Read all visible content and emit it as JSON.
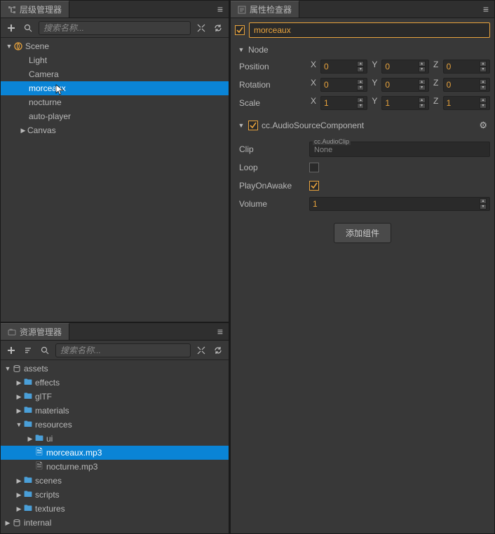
{
  "hierarchy": {
    "title": "层级管理器",
    "search_placeholder": "搜索名称...",
    "scene_label": "Scene",
    "nodes": [
      "Light",
      "Camera",
      "morceaux",
      "nocturne",
      "auto-player",
      "Canvas"
    ],
    "selected": "morceaux"
  },
  "assets": {
    "title": "资源管理器",
    "search_placeholder": "搜索名称...",
    "root": "assets",
    "folders": [
      "effects",
      "glTF",
      "materials"
    ],
    "resources_label": "resources",
    "ui_label": "ui",
    "files": [
      "morceaux.mp3",
      "nocturne.mp3"
    ],
    "selected": "morceaux.mp3",
    "folders2": [
      "scenes",
      "scripts",
      "textures"
    ],
    "internal": "internal"
  },
  "inspector": {
    "title": "属性检查器",
    "node_name": "morceaux",
    "node_section": "Node",
    "position_label": "Position",
    "rotation_label": "Rotation",
    "scale_label": "Scale",
    "x": "X",
    "y": "Y",
    "z": "Z",
    "position": {
      "x": "0",
      "y": "0",
      "z": "0"
    },
    "rotation": {
      "x": "0",
      "y": "0",
      "z": "0"
    },
    "scale": {
      "x": "1",
      "y": "1",
      "z": "1"
    },
    "comp_name": "cc.AudioSourceComponent",
    "clip_label": "Clip",
    "clip_type": "cc.AudioClip",
    "clip_value": "None",
    "loop_label": "Loop",
    "loop": false,
    "play_awake_label": "PlayOnAwake",
    "play_awake": true,
    "volume_label": "Volume",
    "volume": "1",
    "add_comp": "添加组件"
  }
}
